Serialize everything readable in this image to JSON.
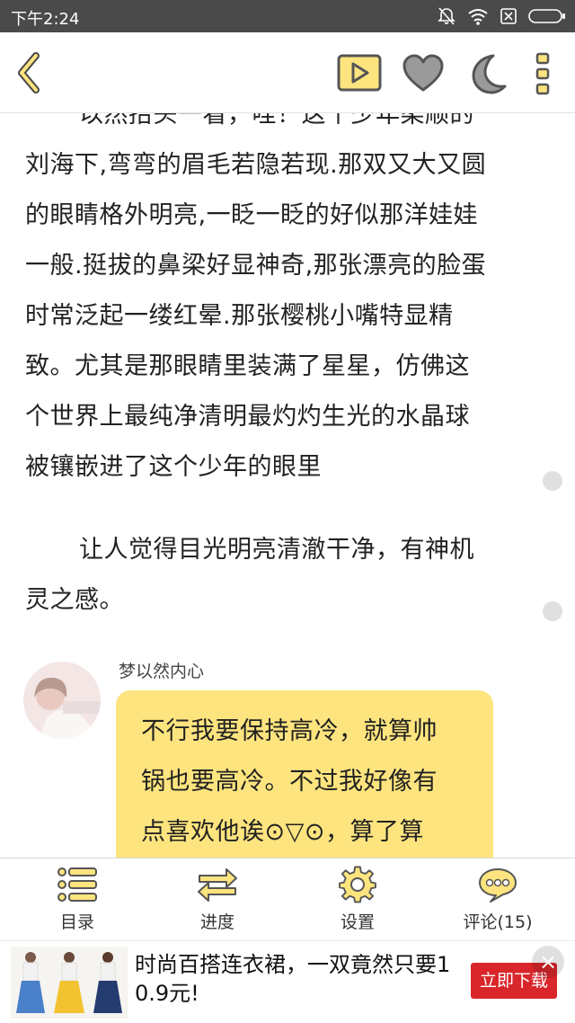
{
  "status_bar": {
    "time": "下午2:24",
    "icons": [
      "bell-off-icon",
      "wifi-icon",
      "sim-none-icon",
      "battery-icon"
    ]
  },
  "toolbar": {
    "buttons": [
      "back-icon",
      "play-icon",
      "heart-icon",
      "night-mode-icon",
      "more-icon"
    ]
  },
  "reader": {
    "cut_paragraph": [
      "以然抬头一看，哇！这个少年柔顺的",
      "刘海下,弯弯的眉毛若隐若现.那双又大又圆",
      "的眼睛格外明亮,一眨一眨的好似那洋娃娃",
      "一般.挺拔的鼻梁好显神奇,那张漂亮的脸蛋",
      "时常泛起一缕红晕.那张樱桃小嘴特显精",
      "致。尤其是那眼睛里装满了星星，仿佛这",
      "个世界上最纯净清明最灼灼生光的水晶球",
      "被镶嵌进了这个少年的眼里"
    ],
    "paragraph_2": [
      "让人觉得目光明亮清澈干净，有神机",
      "灵之感。"
    ],
    "chat": {
      "speaker": "梦以然内心",
      "lines": [
        "不行我要保持高冷，就算帅",
        "锅也要高冷。不过我好像有",
        "点喜欢他诶⊙▽⊙，算了算"
      ]
    }
  },
  "bottom_menu": {
    "items": [
      {
        "label": "目录",
        "icon": "catalog-icon"
      },
      {
        "label": "进度",
        "icon": "progress-icon"
      },
      {
        "label": "设置",
        "icon": "settings-icon"
      },
      {
        "label": "评论(15)",
        "icon": "comment-icon"
      }
    ]
  },
  "ad": {
    "lines": [
      "时尚百搭连衣裙，一双竟然只要1",
      "0.9元!"
    ],
    "button": "立即下载",
    "close": "×"
  },
  "colors": {
    "accent_yellow": "#fde47e",
    "icon_gray": "#9a9a9a",
    "ad_red": "#d9262b"
  }
}
